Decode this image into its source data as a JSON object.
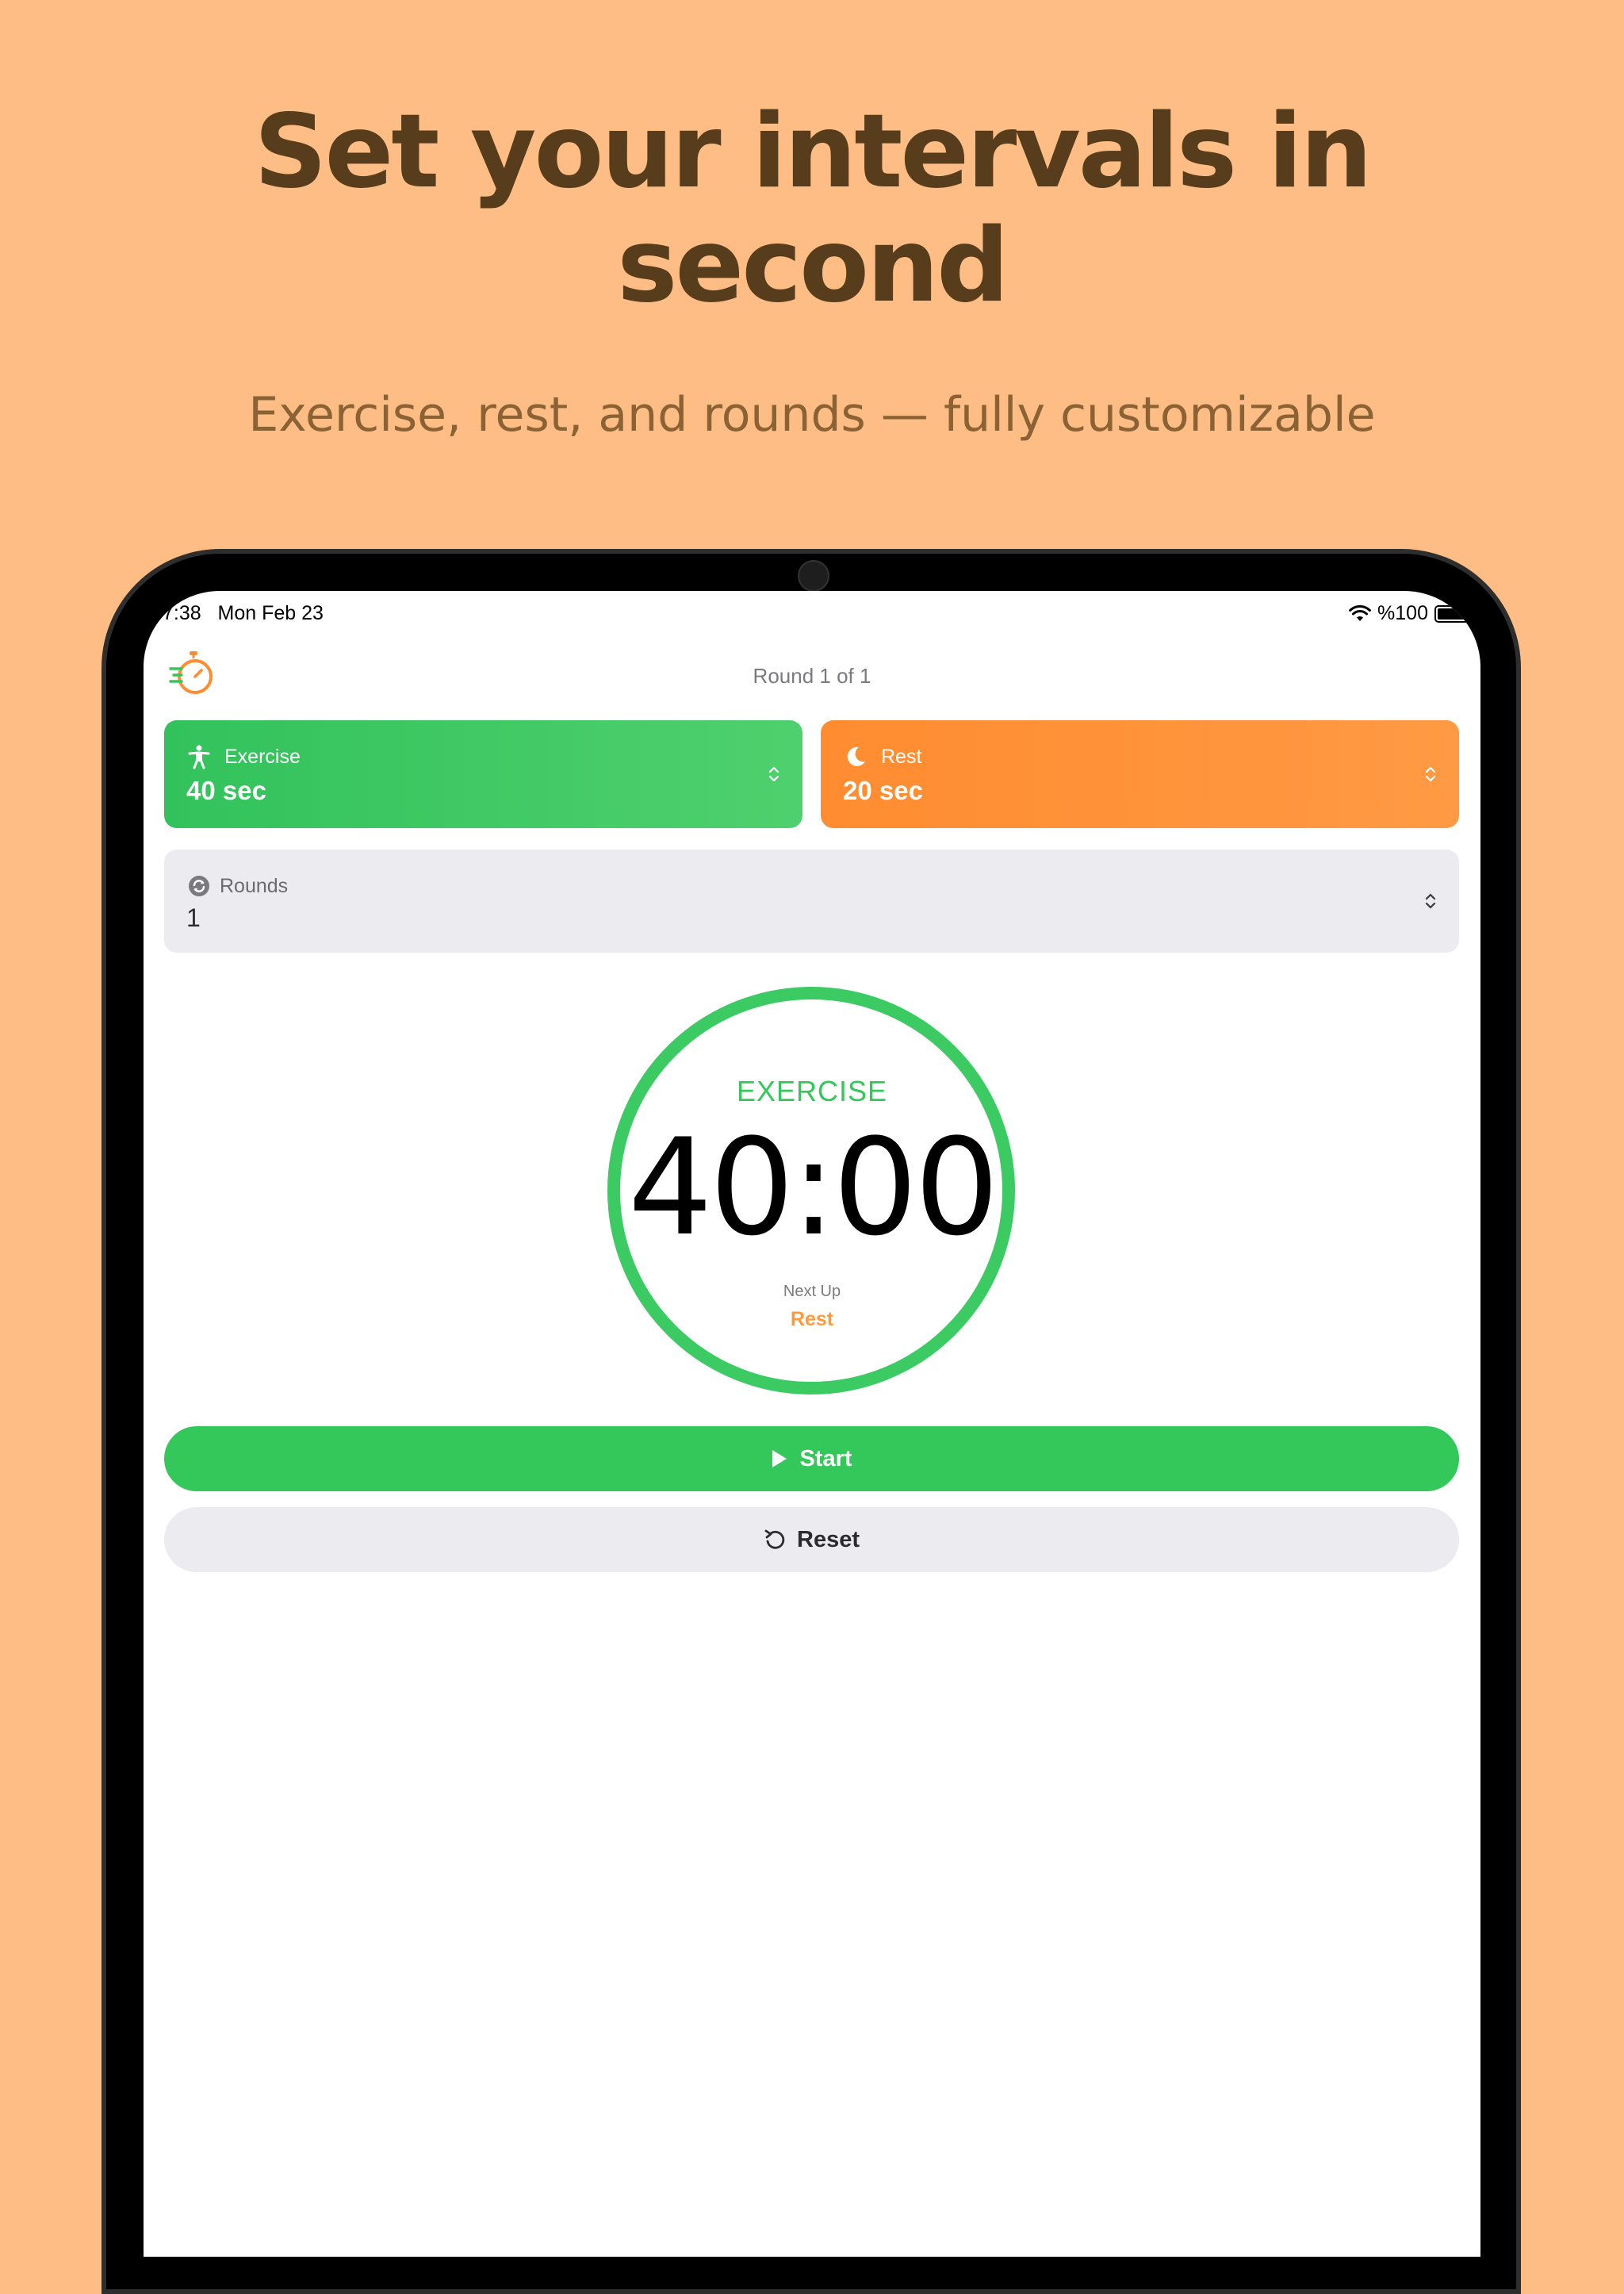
{
  "promo": {
    "headline_line1": "Set your intervals in",
    "headline_line2": "second",
    "subheadline": "Exercise, rest, and rounds — fully customizable"
  },
  "status_bar": {
    "time": "7:38",
    "date": "Mon Feb 23",
    "battery": "%100",
    "icons": [
      "wifi-icon",
      "battery-icon"
    ]
  },
  "header": {
    "round_label": "Round 1 of 1",
    "logo_icon": "stopwatch-icon"
  },
  "settings": {
    "exercise": {
      "label": "Exercise",
      "value": "40 sec",
      "icon": "person-workout-icon",
      "color": "#34C759"
    },
    "rest": {
      "label": "Rest",
      "value": "20 sec",
      "icon": "moon-icon",
      "color": "#FF9230"
    },
    "rounds": {
      "label": "Rounds",
      "value": "1",
      "icon": "repeat-icon"
    }
  },
  "timer": {
    "phase": "EXERCISE",
    "time": "40:00",
    "next_up_label": "Next Up",
    "next_up_value": "Rest",
    "ring_color": "#3CCB62",
    "progress": 1.0
  },
  "actions": {
    "start_label": "Start",
    "reset_label": "Reset"
  },
  "colors": {
    "background": "#FFBD86",
    "headline": "#573D1C",
    "accent_green": "#34C759",
    "accent_orange": "#FF9A3C"
  }
}
